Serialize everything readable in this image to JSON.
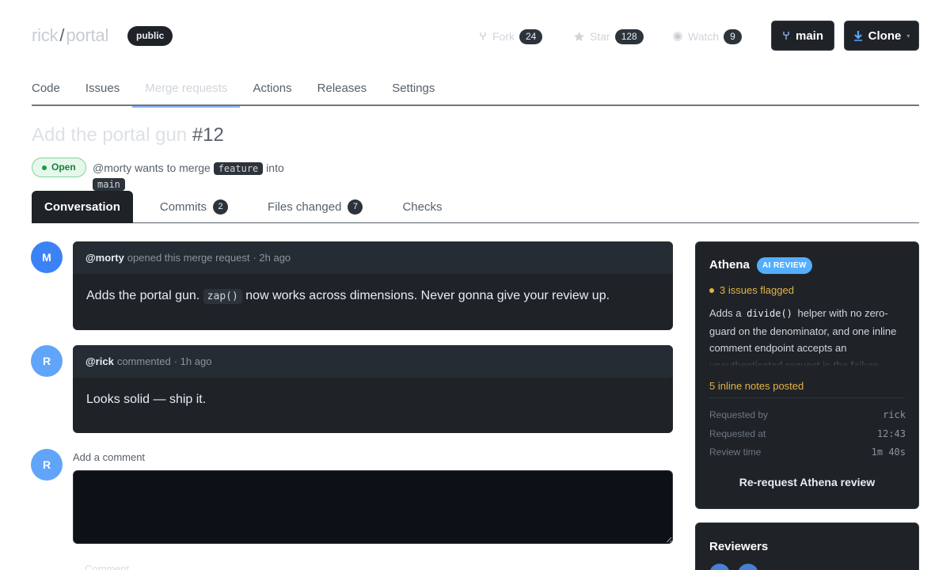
{
  "repo": {
    "owner": "rick",
    "name": "portal",
    "visibility": "public"
  },
  "header": {
    "fork": {
      "label": "Fork",
      "count": "24"
    },
    "star": {
      "label": "Star",
      "count": "128"
    },
    "watch": {
      "label": "Watch",
      "count": "9"
    },
    "branch_button": "main",
    "clone_button": "Clone"
  },
  "repo_tabs": [
    "Code",
    "Issues",
    "Merge requests",
    "Actions",
    "Releases",
    "Settings"
  ],
  "repo_tabs_active": "Merge requests",
  "mr": {
    "title": "Add the portal gun",
    "number": "#12",
    "state": "Open",
    "meta_prefix": "@morty wants to merge",
    "source_branch": "feature",
    "meta_into": "into",
    "target_branch": "main"
  },
  "mr_tabs": [
    {
      "label": "Conversation",
      "count": ""
    },
    {
      "label": "Commits",
      "count": "2"
    },
    {
      "label": "Files changed",
      "count": "7"
    },
    {
      "label": "Checks",
      "count": ""
    }
  ],
  "comments": [
    {
      "avatar": "M",
      "author": "@morty",
      "action": "opened this merge request",
      "time": "· 2h ago",
      "body_before": "Adds the portal gun.",
      "body_code": "zap()",
      "body_after": "now works across dimensions. Never gonna give your review up."
    },
    {
      "avatar": "R",
      "author": "@rick",
      "action": "commented",
      "time": "· 1h ago",
      "body": "Looks solid — ship it."
    }
  ],
  "composer": {
    "avatar": "R",
    "label": "Add a comment",
    "button": "Comment"
  },
  "athena": {
    "title": "Athena",
    "badge": "AI REVIEW",
    "flagged": "3 issues flagged",
    "summary_before": "Adds a",
    "summary_code": "divide()",
    "summary_after": "helper with no zero-guard on the denominator, and one inline comment endpoint accepts an unauthenticated request in the failure",
    "inline_notes": "5 inline notes posted",
    "requested_by_label": "Requested by",
    "requested_by": "rick",
    "requested_at_label": "Requested at",
    "requested_at": "12:43",
    "review_time_label": "Review time",
    "review_time": "1m 40s",
    "rerequest": "Re-request Athena review"
  },
  "reviewers": {
    "title": "Reviewers"
  },
  "colors": {
    "accent_blue": "#8ab4f8",
    "open_green": "#1a7f37",
    "warning_yellow": "#e3b341",
    "avatar_m": "#3b82f6",
    "avatar_r": "#60a5fa"
  }
}
